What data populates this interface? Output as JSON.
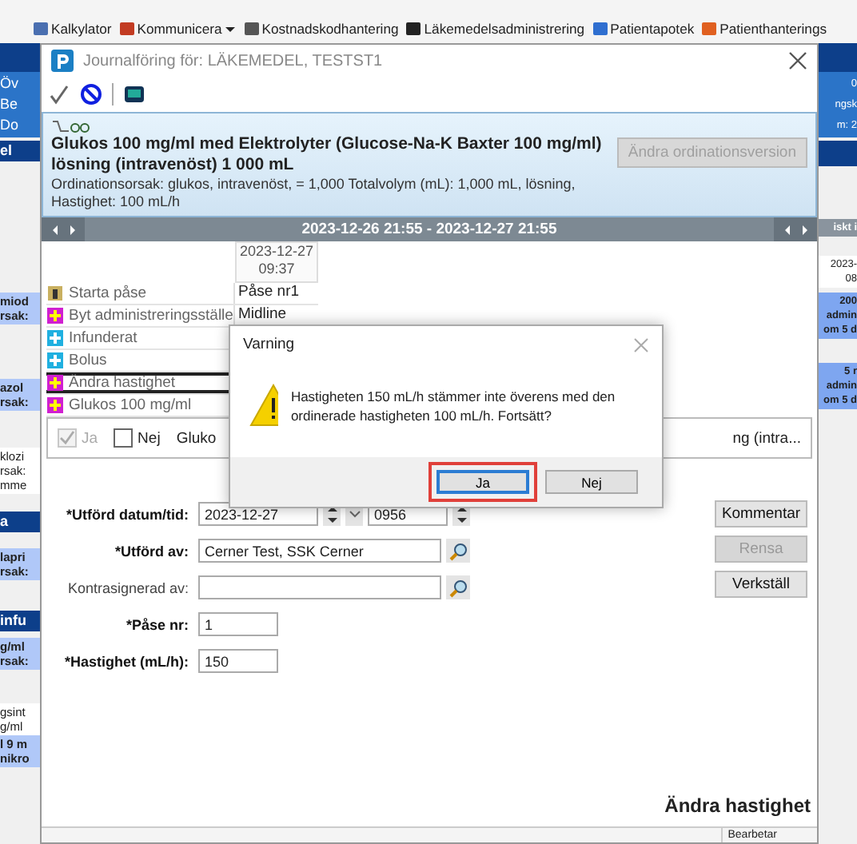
{
  "menu_bar": [
    {
      "label": "Kalkylator",
      "dropdown": false
    },
    {
      "label": "Kommunicera",
      "dropdown": true
    },
    {
      "label": "Kostnadskodhantering",
      "dropdown": false
    },
    {
      "label": "Läkemedelsadministrering",
      "dropdown": false
    },
    {
      "label": "Patientapotek",
      "dropdown": false
    },
    {
      "label": "Patienthanterings",
      "dropdown": false
    }
  ],
  "background_left": [
    {
      "kind": "header",
      "lines": [
        "Öv",
        "Be",
        "Do"
      ]
    },
    {
      "kind": "dark",
      "lines": [
        "el"
      ]
    },
    {
      "kind": "light",
      "lines": [
        "miod",
        "rsak:"
      ]
    },
    {
      "kind": "light",
      "lines": [
        "azol",
        "rsak:"
      ]
    },
    {
      "kind": "plain",
      "lines": [
        "klozi",
        "rsak:",
        "mme"
      ]
    },
    {
      "kind": "dark",
      "lines": [
        "a"
      ]
    },
    {
      "kind": "light",
      "lines": [
        "lapri",
        "rsak:"
      ]
    },
    {
      "kind": "dark",
      "lines": [
        "infu"
      ]
    },
    {
      "kind": "light",
      "lines": [
        "g/ml",
        "rsak:"
      ]
    },
    {
      "kind": "plain",
      "lines": [
        "gsint",
        "g/ml"
      ]
    },
    {
      "kind": "light",
      "lines": [
        "l 9 m",
        "nikro"
      ]
    }
  ],
  "background_right": [
    {
      "kind": "header",
      "lines": [
        "0",
        "ngsk",
        "m: 2"
      ]
    },
    {
      "kind": "gray",
      "lines": [
        "iskt i"
      ]
    },
    {
      "kind": "plain",
      "lines": [
        "2023-",
        "08"
      ]
    },
    {
      "kind": "blue",
      "lines": [
        "200",
        "admin",
        "om 5 d"
      ]
    },
    {
      "kind": "blue",
      "lines": [
        "5 r",
        "admin",
        "om 5 d"
      ]
    }
  ],
  "dialog": {
    "title": "Journalföring för: LÄKEMEDEL, TESTST1",
    "order": {
      "title": "Glukos 100 mg/ml med Elektrolyter (Glucose-Na-K Baxter 100 mg/ml) lösning (intravenöst) 1 000 mL",
      "details": "Ordinationsorsak: glukos, intravenöst, = 1,000 Totalvolym (mL): 1,000 mL, lösning, Hastighet: 100 mL/h",
      "button": {
        "label": "Ändra ordinationsversion",
        "disabled": true
      }
    },
    "timeline": {
      "range": "2023-12-26 21:55 - 2023-12-27 21:55"
    },
    "grid": {
      "date": "2023-12-27",
      "time": "09:37",
      "rows": [
        {
          "kind": "bag",
          "label": "Starta påse",
          "value": "Påse nr1",
          "selected": false
        },
        {
          "kind": "magenta",
          "label": "Byt administreringsställe",
          "value": "Midline",
          "selected": false
        },
        {
          "kind": "cyan",
          "label": "Infunderat",
          "selected": false
        },
        {
          "kind": "cyan",
          "label": "Bolus",
          "selected": false
        },
        {
          "kind": "magenta",
          "label": "Ändra hastighet",
          "selected": true
        },
        {
          "kind": "magenta",
          "label": "Glukos 100 mg/ml",
          "selected": false
        }
      ]
    },
    "confirm": {
      "options": [
        {
          "label": "Ja",
          "checked": true,
          "disabled": true
        },
        {
          "label": "Nej",
          "checked": false,
          "disabled": false
        }
      ],
      "text_start": "Gluko",
      "text_end": "ng (intra..."
    },
    "form": [
      {
        "kind": "datetime",
        "label": "*Utförd datum/tid:",
        "required": true,
        "value": "2023-12-27",
        "time": "0956"
      },
      {
        "kind": "search",
        "label": "*Utförd av:",
        "required": true,
        "value": "Cerner Test, SSK Cerner"
      },
      {
        "kind": "search",
        "label": "Kontrasignerad av:",
        "required": false
      },
      {
        "kind": "short",
        "label": "*Påse nr:",
        "required": true,
        "value": "1"
      },
      {
        "kind": "short",
        "label": "*Hastighet (mL/h):",
        "required": true,
        "value": "150"
      }
    ],
    "actions": [
      {
        "label": "Kommentar",
        "disabled": false
      },
      {
        "label": "Rensa",
        "disabled": true
      },
      {
        "label": "Verkställ",
        "disabled": false
      }
    ],
    "footer_title": "Ändra hastighet",
    "status": "Bearbetar"
  },
  "warning": {
    "title": "Varning",
    "message": "Hastigheten 150 mL/h stämmer inte överens med den ordinerade hastigheten 100 mL/h. Fortsätt?",
    "buttons": [
      {
        "label": "Ja",
        "selected": true,
        "highlighted": true
      },
      {
        "label": "Nej",
        "selected": false,
        "highlighted": false
      }
    ]
  }
}
